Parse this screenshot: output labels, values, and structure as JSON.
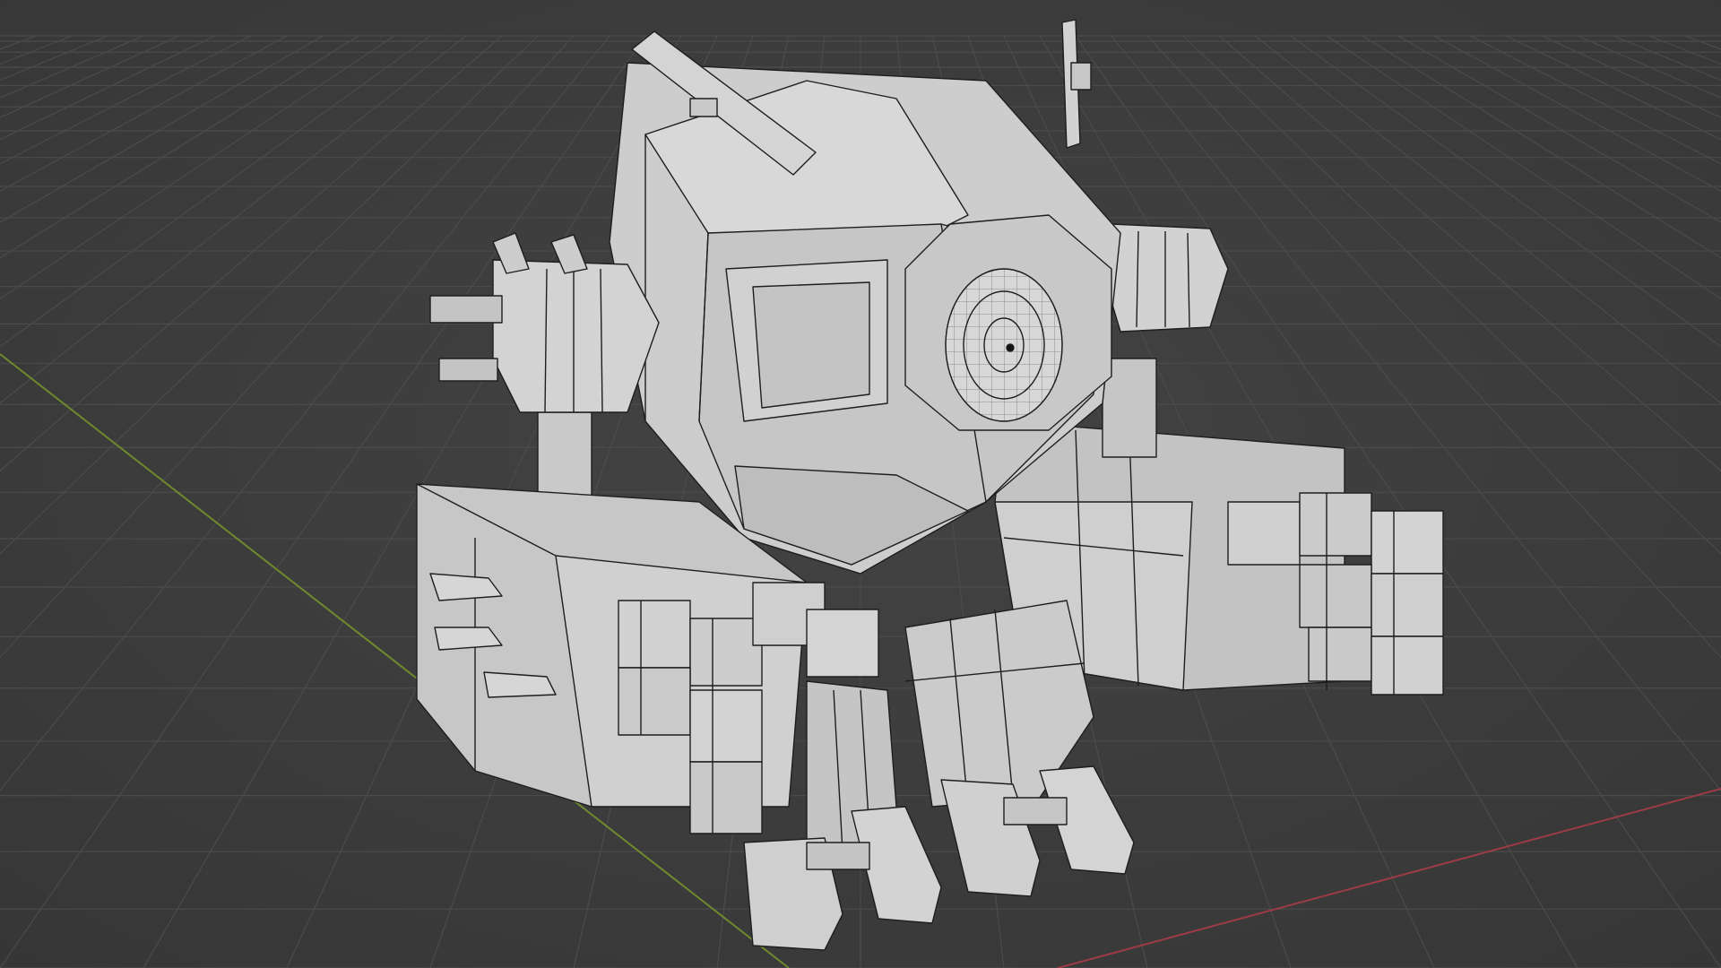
{
  "app": "3D viewport",
  "viewport": {
    "mode": "solid-shading-wireframe-overlay",
    "background_color": "#3d3d3d",
    "grid_color": "#4a4a4a",
    "x_axis_color": "#9c3b45",
    "y_axis_color": "#6f8a2e",
    "model_face_color": "#c9c9c9",
    "model_shadow_color": "#a9a9a9",
    "model_edge_color": "#1e1e1e"
  },
  "model": {
    "name": "mech-robot",
    "parts": [
      "head",
      "eye",
      "left-antenna",
      "right-antenna",
      "left-shoulder-pod",
      "right-shoulder-pod",
      "left-arm-block",
      "right-arm-block",
      "left-fist",
      "right-fist",
      "left-leg",
      "right-leg",
      "left-foot",
      "right-foot"
    ]
  }
}
